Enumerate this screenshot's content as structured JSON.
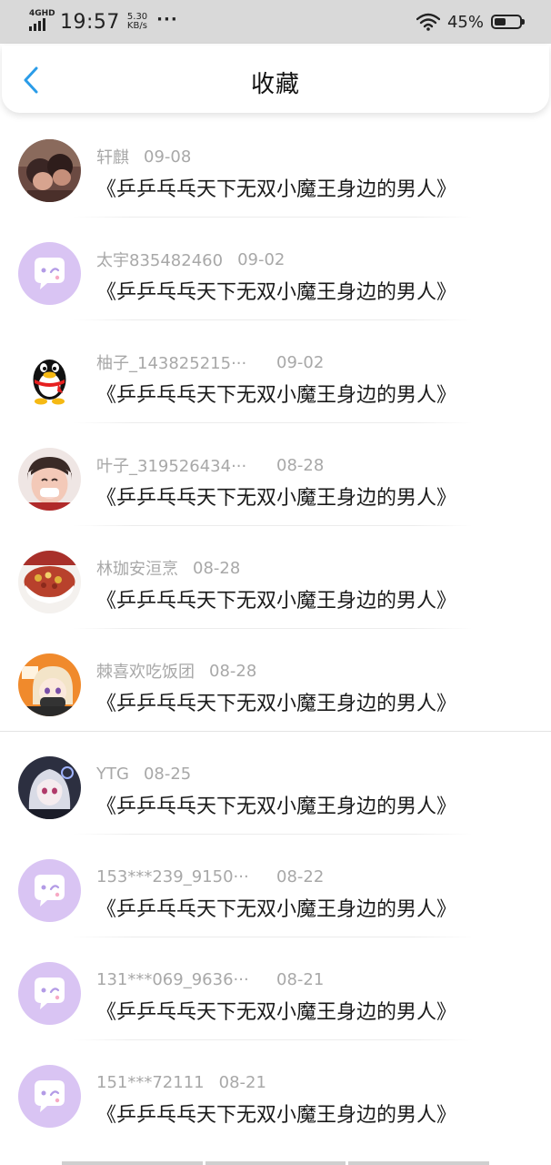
{
  "status_bar": {
    "network": "4GHD",
    "time": "19:57",
    "speed_value": "5.30",
    "speed_unit": "KB/s",
    "more": "···",
    "battery_text": "45%",
    "battery_level": 0.45
  },
  "header": {
    "title": "收藏",
    "back_icon": "chevron-left-icon",
    "accent_color": "#2a9ce8"
  },
  "favorites": [
    {
      "username": "轩麒",
      "date": "09-08",
      "title": "《乒乒乓乓天下无双小魔王身边的男人》",
      "avatar": "photo-two-kids",
      "truncated": false
    },
    {
      "username": "太宇835482460",
      "date": "09-02",
      "title": "《乒乒乓乓天下无双小魔王身边的男人》",
      "avatar": "default-chat-bubble",
      "truncated": false
    },
    {
      "username": "柚子_143825215···",
      "date": "09-02",
      "title": "《乒乒乓乓天下无双小魔王身边的男人》",
      "avatar": "qq-penguin",
      "truncated": true
    },
    {
      "username": "叶子_319526434···",
      "date": "08-28",
      "title": "《乒乒乓乓天下无双小魔王身边的男人》",
      "avatar": "photo-child",
      "truncated": true
    },
    {
      "username": "林珈安洹烹",
      "date": "08-28",
      "title": "《乒乒乓乓天下无双小魔王身边的男人》",
      "avatar": "photo-food-bowl",
      "truncated": false
    },
    {
      "username": "棘喜欢吃饭团",
      "date": "08-28",
      "title": "《乒乒乓乓天下无双小魔王身边的男人》",
      "avatar": "anime-girl-orange",
      "truncated": false
    },
    {
      "username": "YTG",
      "date": "08-25",
      "title": "《乒乒乓乓天下无双小魔王身边的男人》",
      "avatar": "anime-girl-dark",
      "truncated": false
    },
    {
      "username": "153***239_9150···",
      "date": "08-22",
      "title": "《乒乒乓乓天下无双小魔王身边的男人》",
      "avatar": "default-chat-bubble",
      "truncated": true
    },
    {
      "username": "131***069_9636···",
      "date": "08-21",
      "title": "《乒乒乓乓天下无双小魔王身边的男人》",
      "avatar": "default-chat-bubble",
      "truncated": true
    },
    {
      "username": "151***72111",
      "date": "08-21",
      "title": "《乒乒乓乓天下无双小魔王身边的男人》",
      "avatar": "default-chat-bubble",
      "truncated": false
    }
  ],
  "colors": {
    "status_bar_bg": "#d9d9d9",
    "meta_text": "#a8a8a8",
    "default_avatar_bg": "#d9c4f3",
    "title_text": "#1a1a1a"
  }
}
